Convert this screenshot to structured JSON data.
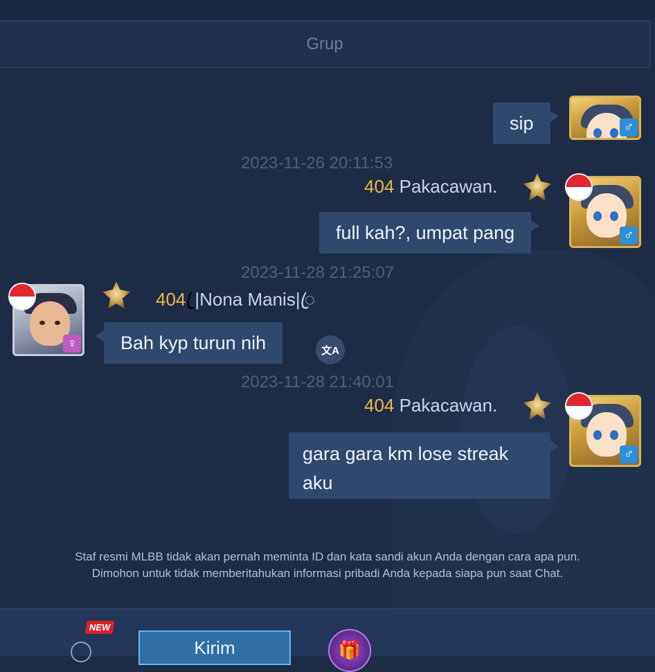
{
  "tab": {
    "label": "Grup"
  },
  "messages": [
    {
      "text": "sip"
    },
    {
      "timestamp": "2023-11-26 20:11:53",
      "sender_level": "404",
      "sender_name": "Pakacawan.",
      "text": "full kah?, umpat pang"
    },
    {
      "timestamp": "2023-11-28 21:25:07",
      "sender_level": "404",
      "sender_name": "ꦿ|Nona Manis|ꦿ",
      "text": "Bah kyp turun nih"
    },
    {
      "timestamp": "2023-11-28 21:40:01",
      "sender_level": "404",
      "sender_name": "Pakacawan.",
      "text_line1": "gara gara km lose streak",
      "text_line2": "aku"
    }
  ],
  "icons": {
    "male": "♂",
    "female": "♀",
    "translate": "文A",
    "gift": "gift-icon"
  },
  "notice": {
    "line1": "Staf resmi MLBB tidak akan pernah meminta ID dan kata sandi akun Anda dengan cara apa pun.",
    "line2": "Dimohon untuk tidak memberitahukan informasi pribadi Anda kepada siapa pun saat Chat."
  },
  "bottom": {
    "new_badge": "NEW",
    "send_label": "Kirim"
  },
  "colors": {
    "background": "#1d2b45",
    "bubble": "#30486c",
    "level": "#e8b84a",
    "send": "#2f6fa6"
  }
}
